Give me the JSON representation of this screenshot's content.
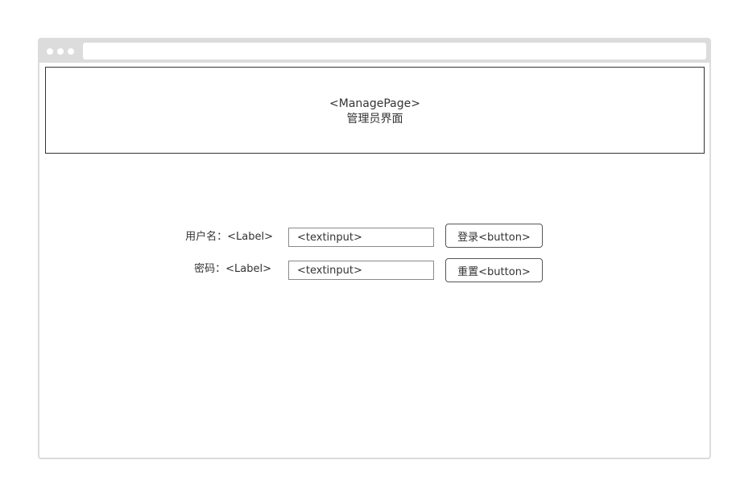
{
  "header": {
    "component": "<ManagePage>",
    "title": "管理员界面"
  },
  "form": {
    "username": {
      "label": "用户名：<Label>",
      "input": "<textinput>"
    },
    "password": {
      "label": "密码：<Label>",
      "input": "<textinput>"
    },
    "login_button": "登录<button>",
    "reset_button": "重置<button>"
  },
  "colors": {
    "frame": "#dcdcdc",
    "border": "#333333",
    "text": "#333333"
  }
}
